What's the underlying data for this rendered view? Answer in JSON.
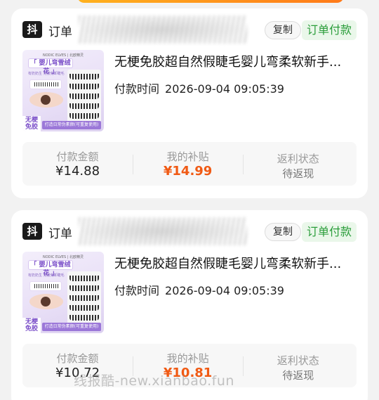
{
  "orders": [
    {
      "platform_icon": "抖",
      "order_label": "订单",
      "copy_label": "复制",
      "status_label": "订单付款",
      "product_title": "无梗免胶超自然假睫毛婴儿弯柔软新手...",
      "pay_time_label": "付款时间",
      "pay_time_value": "2026-09-04 09:05:39",
      "thumb": {
        "brand": "NODIC ELVES | 北欧精灵",
        "banner": "「 婴儿弯雪绒花 」",
        "sub": "有奶奶生 免胶免卸睫毛",
        "badge": "无梗 免胶",
        "foot": "打造日常伪素颜(可重复使用)"
      },
      "stats": {
        "paid_label": "付款金额",
        "paid_value": "¥14.88",
        "subsidy_label": "我的补贴",
        "subsidy_value": "¥14.99",
        "rebate_label": "返利状态",
        "rebate_value": "待返现"
      }
    },
    {
      "platform_icon": "抖",
      "order_label": "订单",
      "copy_label": "复制",
      "status_label": "订单付款",
      "product_title": "无梗免胶超自然假睫毛婴儿弯柔软新手...",
      "pay_time_label": "付款时间",
      "pay_time_value": "2026-09-04 09:05:39",
      "thumb": {
        "brand": "NODIC ELVES | 北欧精灵",
        "banner": "「 婴儿弯雪绒花 」",
        "sub": "有奶奶生 免胶免卸睫毛",
        "badge": "无梗 免胶",
        "foot": "打造日常伪素颜(可重复使用)"
      },
      "stats": {
        "paid_label": "付款金额",
        "paid_value": "¥10.72",
        "subsidy_label": "我的补贴",
        "subsidy_value": "¥10.81",
        "rebate_label": "返利状态",
        "rebate_value": "待返现"
      }
    }
  ],
  "watermark": "线报酷-new.xianbao.fun",
  "colors": {
    "accent_orange": "#f05a14",
    "status_green": "#2a9d3a",
    "status_green_bg": "#eaf7ea"
  }
}
